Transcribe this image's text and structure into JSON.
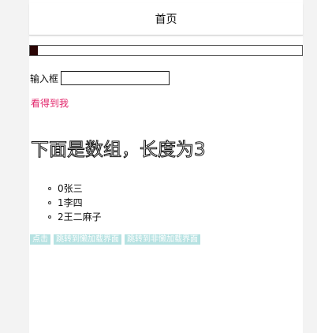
{
  "navbar": {
    "title": "首页"
  },
  "progress": {
    "value": 0.03
  },
  "form": {
    "input_label": "输入框",
    "input_value": ""
  },
  "visible_text": "看得到我",
  "heading": "下面是数组，长度为3",
  "list": {
    "items": [
      "0张三",
      "1李四",
      "2王二麻子"
    ]
  },
  "buttons": {
    "click": "点击",
    "goto_loaded": "跳转到懒加载界面",
    "goto_non_loaded": "跳转到非懒加载界面"
  },
  "colors": {
    "accent_text": "#e2246a",
    "button_bg": "#b6e2e2",
    "progress_fill": "#2b0606"
  }
}
